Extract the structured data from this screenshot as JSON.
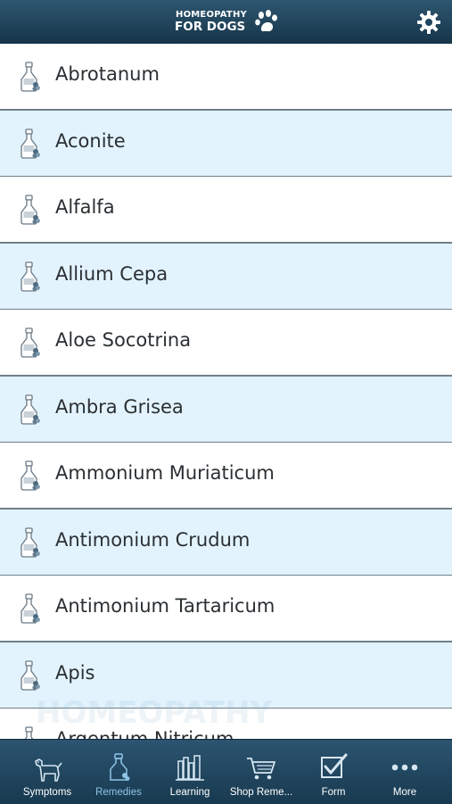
{
  "header": {
    "logo_line1": "HOMEOPATHY",
    "logo_line2": "FOR DOGS",
    "settings_icon": "gear-icon"
  },
  "remedies": [
    {
      "label": "Abrotanum"
    },
    {
      "label": "Aconite"
    },
    {
      "label": "Alfalfa"
    },
    {
      "label": "Allium Cepa"
    },
    {
      "label": "Aloe Socotrina"
    },
    {
      "label": "Ambra Grisea"
    },
    {
      "label": "Ammonium Muriaticum"
    },
    {
      "label": "Antimonium Crudum"
    },
    {
      "label": "Antimonium Tartaricum"
    },
    {
      "label": "Apis"
    },
    {
      "label": "Argentum Nitricum"
    }
  ],
  "watermark": {
    "text": "HOMEOPATHY"
  },
  "tabs": [
    {
      "label": "Symptoms",
      "icon": "dog-icon",
      "active": false
    },
    {
      "label": "Remedies",
      "icon": "bottle-icon",
      "active": true
    },
    {
      "label": "Learning",
      "icon": "books-icon",
      "active": false
    },
    {
      "label": "Shop Reme...",
      "icon": "cart-icon",
      "active": false
    },
    {
      "label": "Form",
      "icon": "checkbox-icon",
      "active": false
    },
    {
      "label": "More",
      "icon": "more-icon",
      "active": false
    }
  ],
  "colors": {
    "header": "#1f4560",
    "row_alt": "#e2f3fd",
    "active_tab": "#8fc4e6"
  }
}
